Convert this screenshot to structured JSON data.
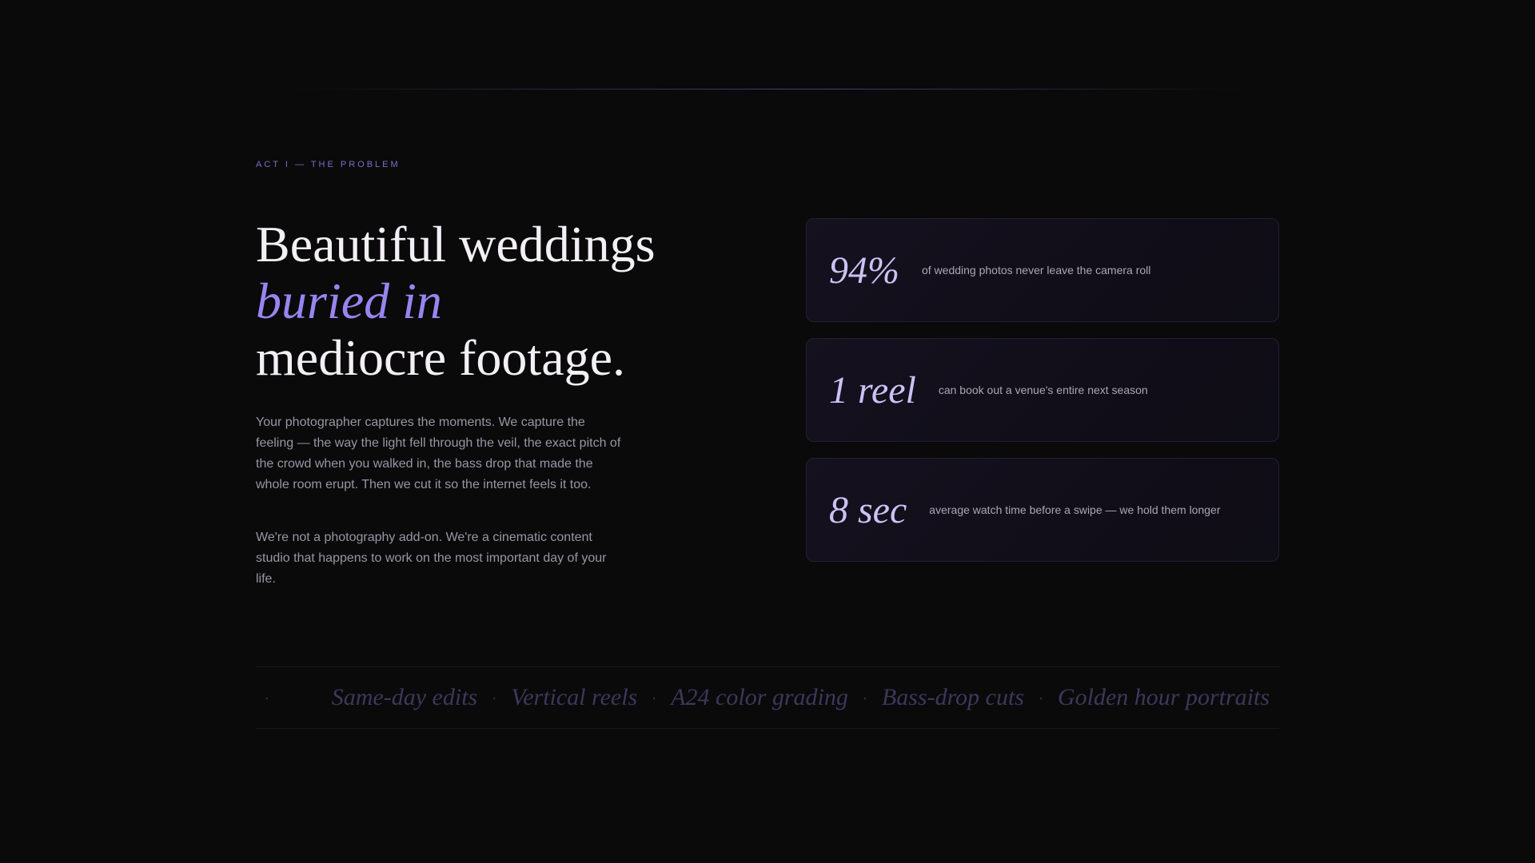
{
  "eyebrow": "ACT I — THE PROBLEM",
  "headline": {
    "line1": "Beautiful weddings",
    "line2_accent": "buried in",
    "line3": "mediocre footage."
  },
  "paragraphs": [
    "Your photographer captures the moments. We capture the feeling — the way the light fell through the veil, the exact pitch of the crowd when you walked in, the bass drop that made the whole room erupt. Then we cut it so the internet feels it too.",
    "We're not a photography add-on. We're a cinematic content studio that happens to work on the most important day of your life."
  ],
  "stats": [
    {
      "value": "94%",
      "label": "of wedding photos never leave the camera roll"
    },
    {
      "value": "1 reel",
      "label": "can book out a venue's entire next season"
    },
    {
      "value": "8 sec",
      "label": "average watch time before a swipe — we hold them longer"
    }
  ],
  "marquee": {
    "separator": "·",
    "items": [
      "Same-day edits",
      "Vertical reels",
      "A24 color grading",
      "Bass-drop cuts",
      "Golden hour portraits"
    ]
  },
  "colors": {
    "background": "#0a0a0b",
    "accent": "#9a84f0",
    "stat_value": "#ccc2f5",
    "eyebrow": "#7b6fc7"
  }
}
